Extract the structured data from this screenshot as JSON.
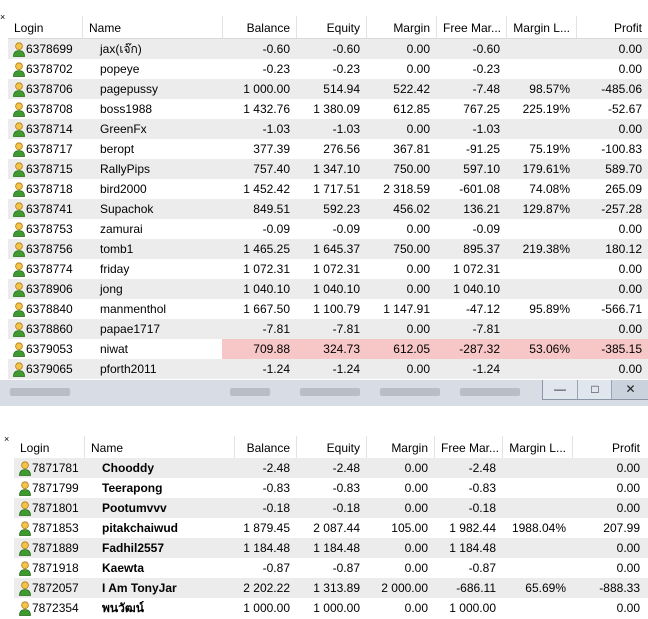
{
  "top_table": {
    "columns": [
      "Login",
      "Name",
      "Balance",
      "Equity",
      "Margin",
      "Free Mar...",
      "Margin L...",
      "Profit"
    ],
    "rows": [
      {
        "login": "6378699",
        "name": "jax(เจ๊ก)",
        "balance": "-0.60",
        "equity": "-0.60",
        "margin": "0.00",
        "free": "-0.60",
        "level": "",
        "profit": "0.00"
      },
      {
        "login": "6378702",
        "name": "popeye",
        "balance": "-0.23",
        "equity": "-0.23",
        "margin": "0.00",
        "free": "-0.23",
        "level": "",
        "profit": "0.00"
      },
      {
        "login": "6378706",
        "name": "pagepussy",
        "balance": "1 000.00",
        "equity": "514.94",
        "margin": "522.42",
        "free": "-7.48",
        "level": "98.57%",
        "profit": "-485.06"
      },
      {
        "login": "6378708",
        "name": "boss1988",
        "balance": "1 432.76",
        "equity": "1 380.09",
        "margin": "612.85",
        "free": "767.25",
        "level": "225.19%",
        "profit": "-52.67"
      },
      {
        "login": "6378714",
        "name": "GreenFx",
        "balance": "-1.03",
        "equity": "-1.03",
        "margin": "0.00",
        "free": "-1.03",
        "level": "",
        "profit": "0.00"
      },
      {
        "login": "6378717",
        "name": "beropt",
        "balance": "377.39",
        "equity": "276.56",
        "margin": "367.81",
        "free": "-91.25",
        "level": "75.19%",
        "profit": "-100.83"
      },
      {
        "login": "6378715",
        "name": "RallyPips",
        "balance": "757.40",
        "equity": "1 347.10",
        "margin": "750.00",
        "free": "597.10",
        "level": "179.61%",
        "profit": "589.70"
      },
      {
        "login": "6378718",
        "name": "bird2000",
        "balance": "1 452.42",
        "equity": "1 717.51",
        "margin": "2 318.59",
        "free": "-601.08",
        "level": "74.08%",
        "profit": "265.09"
      },
      {
        "login": "6378741",
        "name": "Supachok",
        "balance": "849.51",
        "equity": "592.23",
        "margin": "456.02",
        "free": "136.21",
        "level": "129.87%",
        "profit": "-257.28"
      },
      {
        "login": "6378753",
        "name": "zamurai",
        "balance": "-0.09",
        "equity": "-0.09",
        "margin": "0.00",
        "free": "-0.09",
        "level": "",
        "profit": "0.00"
      },
      {
        "login": "6378756",
        "name": "tomb1",
        "balance": "1 465.25",
        "equity": "1 645.37",
        "margin": "750.00",
        "free": "895.37",
        "level": "219.38%",
        "profit": "180.12"
      },
      {
        "login": "6378774",
        "name": "friday",
        "balance": "1 072.31",
        "equity": "1 072.31",
        "margin": "0.00",
        "free": "1 072.31",
        "level": "",
        "profit": "0.00"
      },
      {
        "login": "6378906",
        "name": "jong",
        "balance": "1 040.10",
        "equity": "1 040.10",
        "margin": "0.00",
        "free": "1 040.10",
        "level": "",
        "profit": "0.00"
      },
      {
        "login": "6378840",
        "name": "manmenthol",
        "balance": "1 667.50",
        "equity": "1 100.79",
        "margin": "1 147.91",
        "free": "-47.12",
        "level": "95.89%",
        "profit": "-566.71"
      },
      {
        "login": "6378860",
        "name": "papae1717",
        "balance": "-7.81",
        "equity": "-7.81",
        "margin": "0.00",
        "free": "-7.81",
        "level": "",
        "profit": "0.00"
      },
      {
        "login": "6379053",
        "name": "niwat",
        "balance": "709.88",
        "equity": "324.73",
        "margin": "612.05",
        "free": "-287.32",
        "level": "53.06%",
        "profit": "-385.15",
        "highlight": true
      },
      {
        "login": "6379065",
        "name": "pforth2011",
        "balance": "-1.24",
        "equity": "-1.24",
        "margin": "0.00",
        "free": "-1.24",
        "level": "",
        "profit": "0.00"
      }
    ]
  },
  "window_controls": {
    "minimize": "—",
    "maximize": "□",
    "close": "✕"
  },
  "close_glyph": "×",
  "bottom_table": {
    "columns": [
      "Login",
      "Name",
      "Balance",
      "Equity",
      "Margin",
      "Free Mar...",
      "Margin L...",
      "Profit"
    ],
    "rows": [
      {
        "login": "7871781",
        "name": "Chooddy",
        "balance": "-2.48",
        "equity": "-2.48",
        "margin": "0.00",
        "free": "-2.48",
        "level": "",
        "profit": "0.00"
      },
      {
        "login": "7871799",
        "name": "Teerapong",
        "balance": "-0.83",
        "equity": "-0.83",
        "margin": "0.00",
        "free": "-0.83",
        "level": "",
        "profit": "0.00"
      },
      {
        "login": "7871801",
        "name": "Pootumvvv",
        "balance": "-0.18",
        "equity": "-0.18",
        "margin": "0.00",
        "free": "-0.18",
        "level": "",
        "profit": "0.00"
      },
      {
        "login": "7871853",
        "name": "pitakchaiwud",
        "balance": "1 879.45",
        "equity": "2 087.44",
        "margin": "105.00",
        "free": "1 982.44",
        "level": "1988.04%",
        "profit": "207.99"
      },
      {
        "login": "7871889",
        "name": "Fadhil2557",
        "balance": "1 184.48",
        "equity": "1 184.48",
        "margin": "0.00",
        "free": "1 184.48",
        "level": "",
        "profit": "0.00"
      },
      {
        "login": "7871918",
        "name": "Kaewta",
        "balance": "-0.87",
        "equity": "-0.87",
        "margin": "0.00",
        "free": "-0.87",
        "level": "",
        "profit": "0.00"
      },
      {
        "login": "7872057",
        "name": "I Am TonyJar",
        "balance": "2 202.22",
        "equity": "1 313.89",
        "margin": "2 000.00",
        "free": "-686.11",
        "level": "65.69%",
        "profit": "-888.33"
      },
      {
        "login": "7872354",
        "name": "พนวัฒน์",
        "balance": "1 000.00",
        "equity": "1 000.00",
        "margin": "0.00",
        "free": "1 000.00",
        "level": "",
        "profit": "0.00"
      }
    ]
  }
}
